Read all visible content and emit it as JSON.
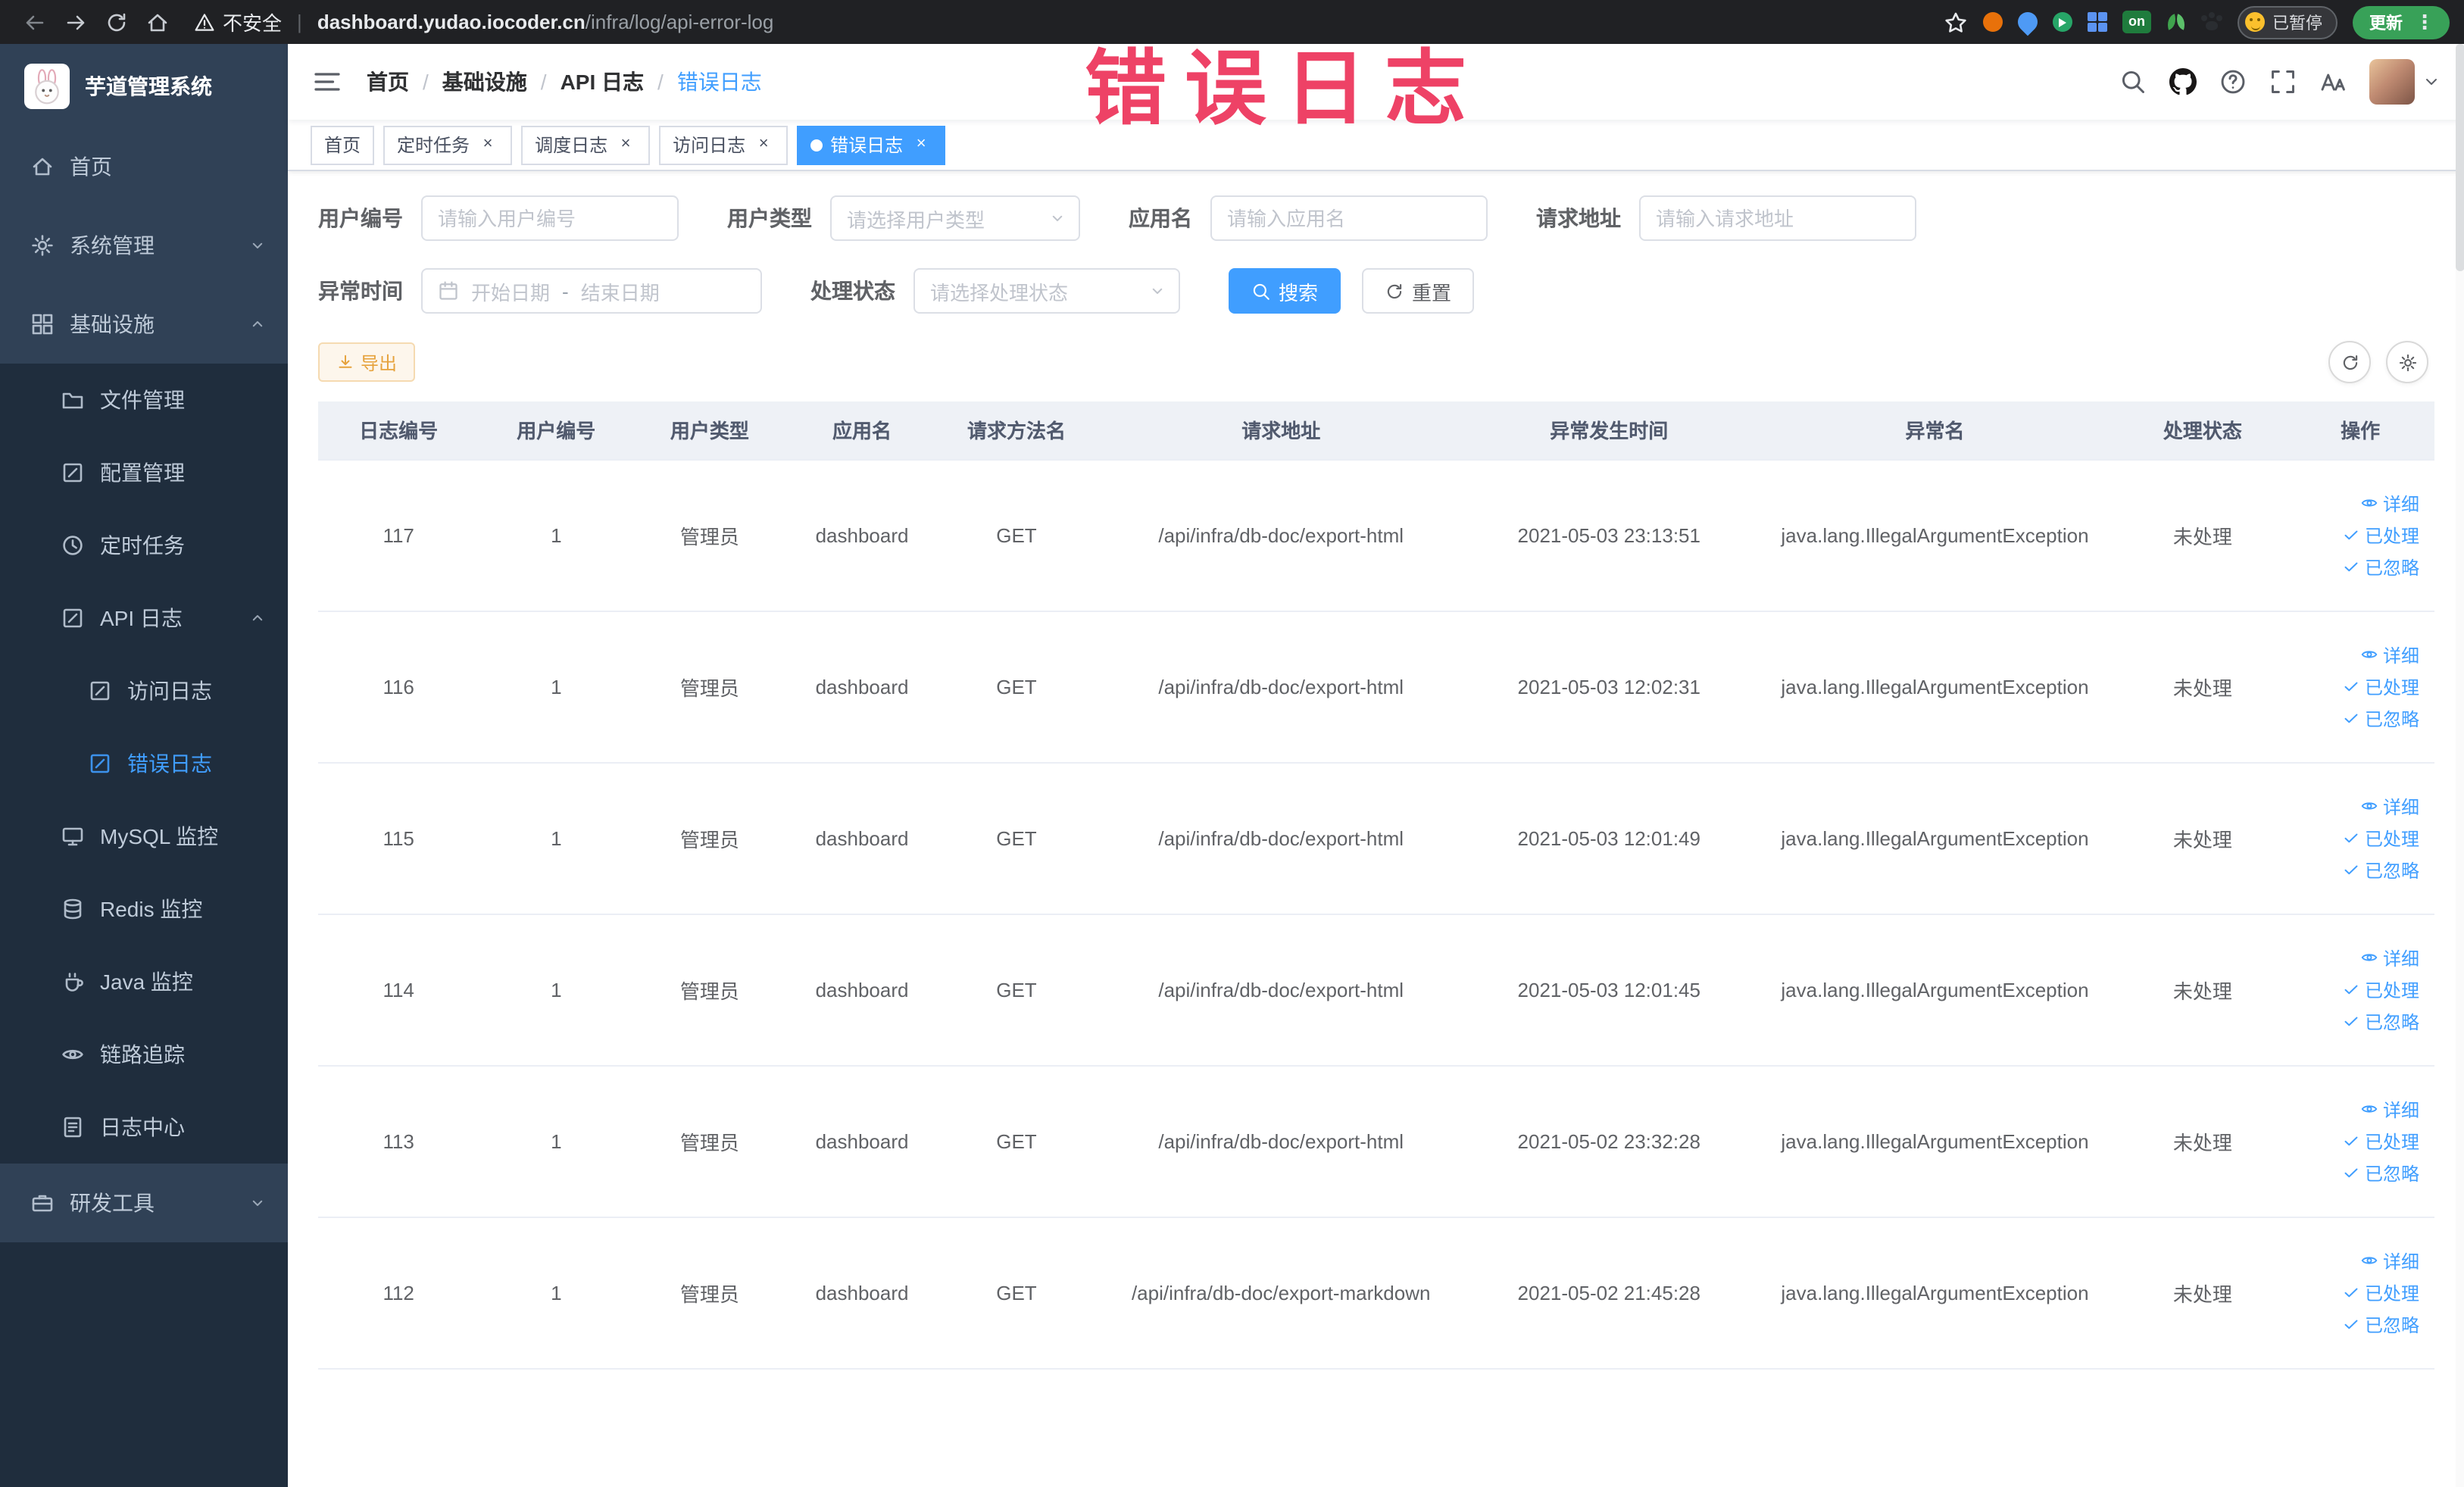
{
  "colors": {
    "accent": "#409eff",
    "warning": "#e6a23c",
    "sidebar_bg": "#304156",
    "sidebar_sub_bg": "#1f2d3d",
    "active_tab_bg": "#409eff",
    "watermark": "#ee4266"
  },
  "browser": {
    "security_label": "不安全",
    "url_domain": "dashboard.yudao.iocoder.cn",
    "url_path": "/infra/log/api-error-log",
    "ext_on_label": "on",
    "paused_label": "已暂停",
    "update_label": "更新"
  },
  "watermark": {
    "text": "错误日志"
  },
  "sidebar": {
    "title": "芋道管理系统",
    "items": [
      {
        "key": "home",
        "label": "首页",
        "icon": "home-icon",
        "level": 1
      },
      {
        "key": "system",
        "label": "系统管理",
        "icon": "gear-icon",
        "level": 1,
        "chevron": "down"
      },
      {
        "key": "infra",
        "label": "基础设施",
        "icon": "grid-icon",
        "level": 1,
        "chevron": "up"
      },
      {
        "key": "file",
        "label": "文件管理",
        "icon": "folder-icon",
        "level": 2
      },
      {
        "key": "config",
        "label": "配置管理",
        "icon": "edit-icon",
        "level": 2
      },
      {
        "key": "job",
        "label": "定时任务",
        "icon": "clock-icon",
        "level": 2
      },
      {
        "key": "api-log",
        "label": "API 日志",
        "icon": "edit-icon",
        "level": 2,
        "chevron": "up"
      },
      {
        "key": "access-log",
        "label": "访问日志",
        "icon": "edit-icon",
        "level": 3
      },
      {
        "key": "error-log",
        "label": "错误日志",
        "icon": "edit-icon",
        "level": 3,
        "active": true
      },
      {
        "key": "mysql",
        "label": "MySQL 监控",
        "icon": "monitor-icon",
        "level": 2
      },
      {
        "key": "redis",
        "label": "Redis 监控",
        "icon": "db-icon",
        "level": 2
      },
      {
        "key": "java",
        "label": "Java 监控",
        "icon": "coffee-icon",
        "level": 2
      },
      {
        "key": "tracer",
        "label": "链路追踪",
        "icon": "eye-icon",
        "level": 2
      },
      {
        "key": "log-center",
        "label": "日志中心",
        "icon": "doc-icon",
        "level": 2
      },
      {
        "key": "dev-tools",
        "label": "研发工具",
        "icon": "tools-icon",
        "level": 1,
        "chevron": "down"
      }
    ]
  },
  "breadcrumb": [
    "首页",
    "基础设施",
    "API 日志",
    "错误日志"
  ],
  "tabs": [
    {
      "key": "home",
      "label": "首页",
      "closable": false,
      "active": false
    },
    {
      "key": "job",
      "label": "定时任务",
      "closable": true,
      "active": false
    },
    {
      "key": "job-log",
      "label": "调度日志",
      "closable": true,
      "active": false
    },
    {
      "key": "access-log",
      "label": "访问日志",
      "closable": true,
      "active": false
    },
    {
      "key": "error-log",
      "label": "错误日志",
      "closable": true,
      "active": true
    }
  ],
  "filters": {
    "user_id": {
      "label": "用户编号",
      "placeholder": "请输入用户编号"
    },
    "user_type": {
      "label": "用户类型",
      "placeholder": "请选择用户类型"
    },
    "app_name": {
      "label": "应用名",
      "placeholder": "请输入应用名"
    },
    "request_url": {
      "label": "请求地址",
      "placeholder": "请输入请求地址"
    },
    "exception_time": {
      "label": "异常时间",
      "start_placeholder": "开始日期",
      "separator": "-",
      "end_placeholder": "结束日期"
    },
    "process_status": {
      "label": "处理状态",
      "placeholder": "请选择处理状态"
    },
    "search_label": "搜索",
    "reset_label": "重置"
  },
  "toolbar": {
    "export_label": "导出"
  },
  "table": {
    "headers": [
      "日志编号",
      "用户编号",
      "用户类型",
      "应用名",
      "请求方法名",
      "请求地址",
      "异常发生时间",
      "异常名",
      "处理状态",
      "操作"
    ],
    "actions": [
      {
        "key": "detail",
        "label": "详细",
        "icon": "eye-icon"
      },
      {
        "key": "processed",
        "label": "已处理",
        "icon": "check-icon"
      },
      {
        "key": "ignored",
        "label": "已忽略",
        "icon": "check-icon"
      }
    ],
    "rows": [
      {
        "log_id": "117",
        "user_id": "1",
        "user_type": "管理员",
        "app_name": "dashboard",
        "method": "GET",
        "url": "/api/infra/db-doc/export-html",
        "time": "2021-05-03 23:13:51",
        "exception": "java.lang.IllegalArgumentException",
        "status": "未处理"
      },
      {
        "log_id": "116",
        "user_id": "1",
        "user_type": "管理员",
        "app_name": "dashboard",
        "method": "GET",
        "url": "/api/infra/db-doc/export-html",
        "time": "2021-05-03 12:02:31",
        "exception": "java.lang.IllegalArgumentException",
        "status": "未处理"
      },
      {
        "log_id": "115",
        "user_id": "1",
        "user_type": "管理员",
        "app_name": "dashboard",
        "method": "GET",
        "url": "/api/infra/db-doc/export-html",
        "time": "2021-05-03 12:01:49",
        "exception": "java.lang.IllegalArgumentException",
        "status": "未处理"
      },
      {
        "log_id": "114",
        "user_id": "1",
        "user_type": "管理员",
        "app_name": "dashboard",
        "method": "GET",
        "url": "/api/infra/db-doc/export-html",
        "time": "2021-05-03 12:01:45",
        "exception": "java.lang.IllegalArgumentException",
        "status": "未处理"
      },
      {
        "log_id": "113",
        "user_id": "1",
        "user_type": "管理员",
        "app_name": "dashboard",
        "method": "GET",
        "url": "/api/infra/db-doc/export-html",
        "time": "2021-05-02 23:32:28",
        "exception": "java.lang.IllegalArgumentException",
        "status": "未处理"
      },
      {
        "log_id": "112",
        "user_id": "1",
        "user_type": "管理员",
        "app_name": "dashboard",
        "method": "GET",
        "url": "/api/infra/db-doc/export-markdown",
        "time": "2021-05-02 21:45:28",
        "exception": "java.lang.IllegalArgumentException",
        "status": "未处理"
      }
    ]
  }
}
